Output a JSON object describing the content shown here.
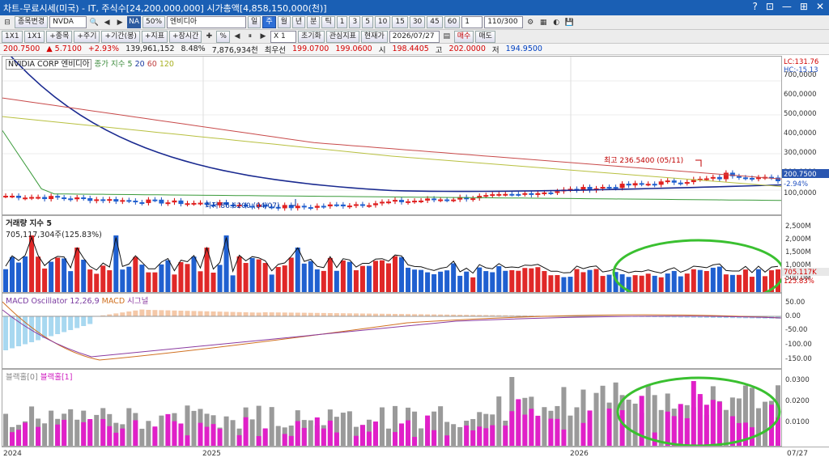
{
  "window": {
    "title": "차트-무료시세(미국) - IT, 주식수[24,200,000,000] 시가총액[4,858,150,000(천)]",
    "controls": [
      "?",
      "⊡",
      "—",
      "⊞",
      "✕"
    ]
  },
  "toolbar1": {
    "items": [
      "종목변경",
      "NVDA",
      "엔비디아",
      "일",
      "주",
      "월",
      "년",
      "분",
      "틱",
      "1",
      "3",
      "5",
      "10",
      "15",
      "30",
      "45",
      "60",
      "1",
      "110/300"
    ],
    "na_tag": "NA",
    "pct": "50%"
  },
  "toolbar2": {
    "items": [
      "1X1",
      "1X1",
      "+종목",
      "+주기",
      "+기간(봉)",
      "+지표",
      "+장시간",
      "%",
      "X 1",
      "초기화",
      "관심지표",
      "현재가",
      "2026/07/27",
      "매수",
      "매도"
    ]
  },
  "quote": {
    "price": "200.7500",
    "change": "▲ 5.7100",
    "rate": "+2.93%",
    "volume": "139,961,152",
    "vol_rate": "8.48%",
    "amount": "7,876,934천",
    "bid_label": "최우선",
    "bid": "199.0700",
    "ask": "199.0600",
    "open_label": "시",
    "open": "198.4405",
    "high_label": "고",
    "high": "202.0000",
    "low_label": "저",
    "low": "194.9500"
  },
  "price_pane": {
    "title": "NVIDIA CORP 엔비디아",
    "ma_label": "종가 지수 5",
    "ma_periods": [
      "20",
      "60",
      "120"
    ],
    "lc": "LC:131.76",
    "hc": "HC:-15.13",
    "high_note": "최고 236.5400 (05/11)",
    "low_note": "최저 86.6200 (04/07)",
    "last_price": "200.7500",
    "last_pct": "-2.94%",
    "axis": [
      "700,0000",
      "600,0000",
      "500,0000",
      "400,0000",
      "300,0000",
      "200,0000",
      "100,0000"
    ]
  },
  "volume_pane": {
    "title": "거래량 지수 5",
    "subtitle": "705,117,304주(125.83%)",
    "axis": [
      "2,500M",
      "2,000M",
      "1,500M",
      "1,000M",
      "500.0M"
    ],
    "tag": "705.117K",
    "tag_pct": "125.83%"
  },
  "macd_pane": {
    "title": "MACD Oscillator 12,26,9",
    "label2": "MACD",
    "label3": "시그널",
    "axis": [
      "50.00",
      "0.00",
      "-50.00",
      "-100.00",
      "-150.00"
    ]
  },
  "block_pane": {
    "title1": "블랙홀[0]",
    "title2": "블랙홀[1]",
    "axis": [
      "0.0300",
      "0.0200",
      "0.0100"
    ]
  },
  "xaxis": {
    "labels": [
      "2024",
      "2025",
      "2026"
    ],
    "end_label": "07/27"
  },
  "chart_data": {
    "type": "bar",
    "title": "NVIDIA CORP 엔비디아",
    "high": 236.54,
    "low": 86.62,
    "last": 200.75,
    "x_labels": [
      "2024",
      "2025",
      "2026"
    ],
    "price_ylim": [
      60,
      720
    ]
  }
}
